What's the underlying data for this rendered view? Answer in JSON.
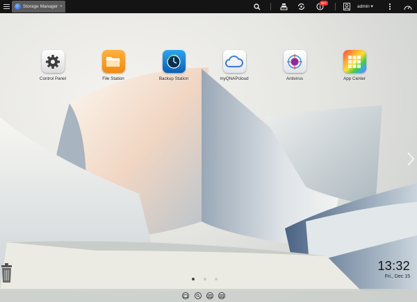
{
  "taskbar": {
    "tab_label": "Storage Manager",
    "tab_close": "×",
    "notification_badge": "50+",
    "user": "admin ▾"
  },
  "apps": [
    {
      "label": "Control Panel",
      "icon": "gear-icon"
    },
    {
      "label": "File Station",
      "icon": "folder-icon"
    },
    {
      "label": "Backup Station",
      "icon": "backup-clock-icon"
    },
    {
      "label": "myQNAPcloud",
      "icon": "cloud-icon"
    },
    {
      "label": "Antivirus",
      "icon": "antivirus-target-icon"
    },
    {
      "label": "App Center",
      "icon": "app-grid-icon"
    }
  ],
  "clock": {
    "time": "13:32",
    "date": "Fri., Dec 15"
  },
  "colors": {
    "topbar": "#141414",
    "file_station": "#f39a1e",
    "backup_station": "#1b7fd4",
    "myqnapcloud": "#3a7bd5"
  }
}
